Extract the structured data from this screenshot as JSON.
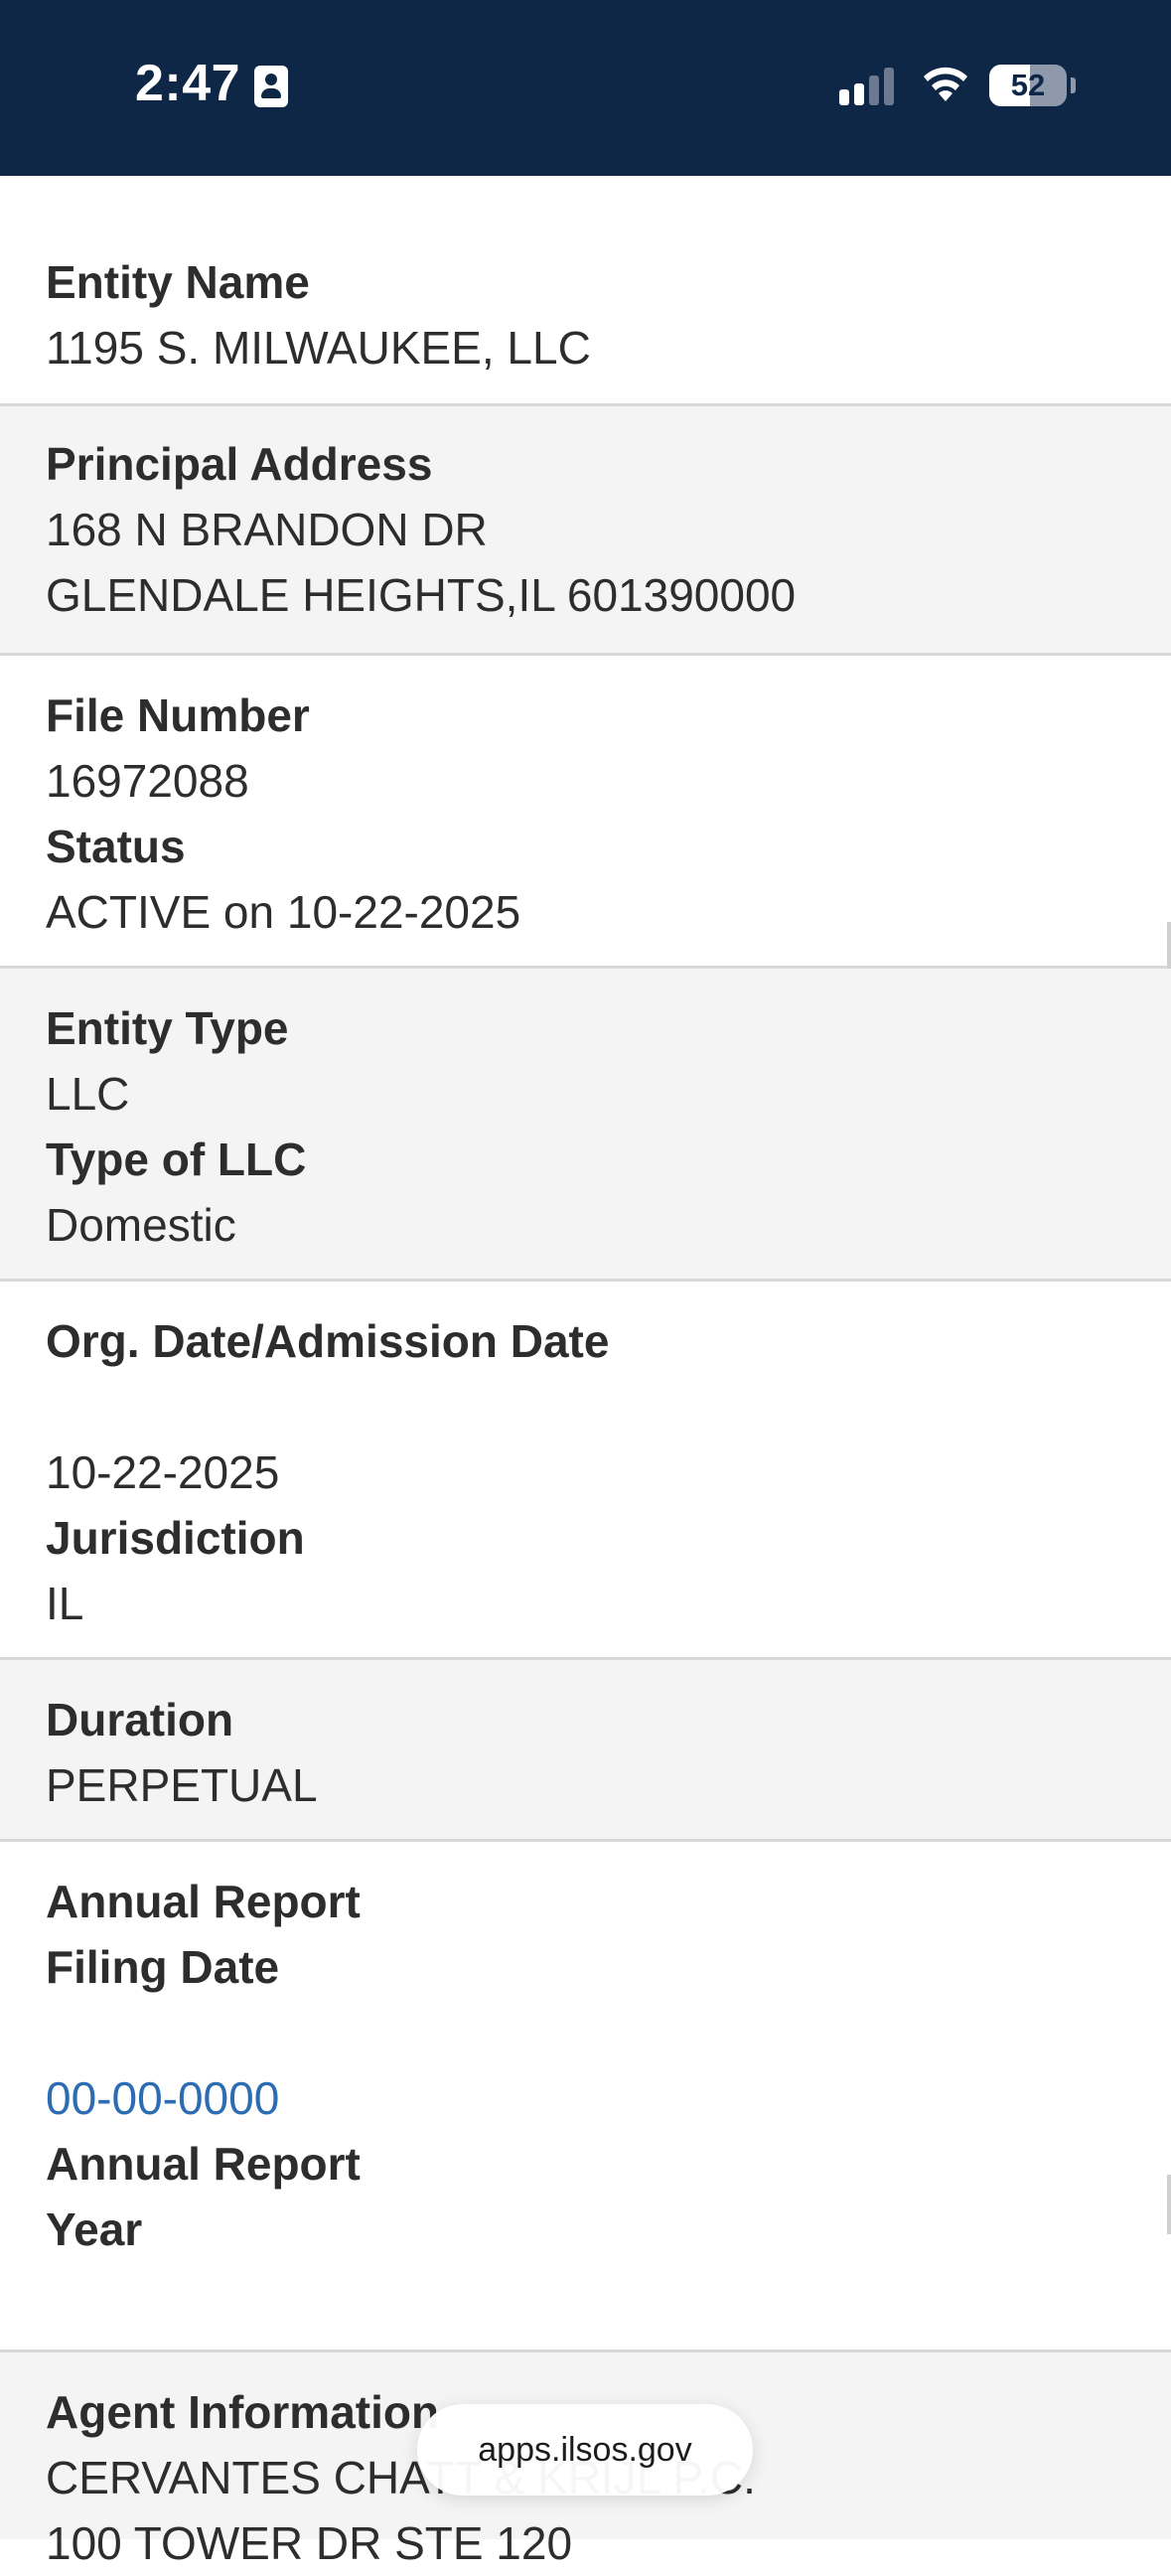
{
  "status_bar": {
    "time": "2:47",
    "battery": "52",
    "battery_level_percent": 52,
    "icons": [
      "person-badge-icon",
      "cellular-signal-icon",
      "wifi-icon",
      "battery-icon"
    ]
  },
  "entity": {
    "entity_name_label": "Entity Name",
    "entity_name": "1195 S. MILWAUKEE, LLC",
    "principal_address_label": "Principal Address",
    "principal_address_line1": "168 N BRANDON DR",
    "principal_address_line2": "GLENDALE HEIGHTS,IL 601390000",
    "file_number_label": "File Number",
    "file_number": "16972088",
    "status_label": "Status",
    "status": "ACTIVE on 10-22-2025",
    "entity_type_label": "Entity Type",
    "entity_type": "LLC",
    "type_of_llc_label": "Type of LLC",
    "type_of_llc": "Domestic",
    "org_date_label": "Org. Date/Admission Date",
    "org_date": "10-22-2025",
    "jurisdiction_label": "Jurisdiction",
    "jurisdiction": "IL",
    "duration_label": "Duration",
    "duration": "PERPETUAL",
    "annual_report_filing_label_1": "Annual Report",
    "annual_report_filing_label_2": "Filing Date",
    "annual_report_filing_date": "00-00-0000",
    "annual_report_year_label_1": "Annual Report",
    "annual_report_year_label_2": "Year",
    "agent_info_label": "Agent Information",
    "agent_name": "CERVANTES CHATT & KRIJL P.C.",
    "agent_address": "100 TOWER DR STE 120"
  },
  "browser": {
    "url": "apps.ilsos.gov"
  },
  "colors": {
    "status_bar_bg": "#0f2747",
    "section_gray": "#f4f4f4",
    "link": "#2b6cb3"
  }
}
